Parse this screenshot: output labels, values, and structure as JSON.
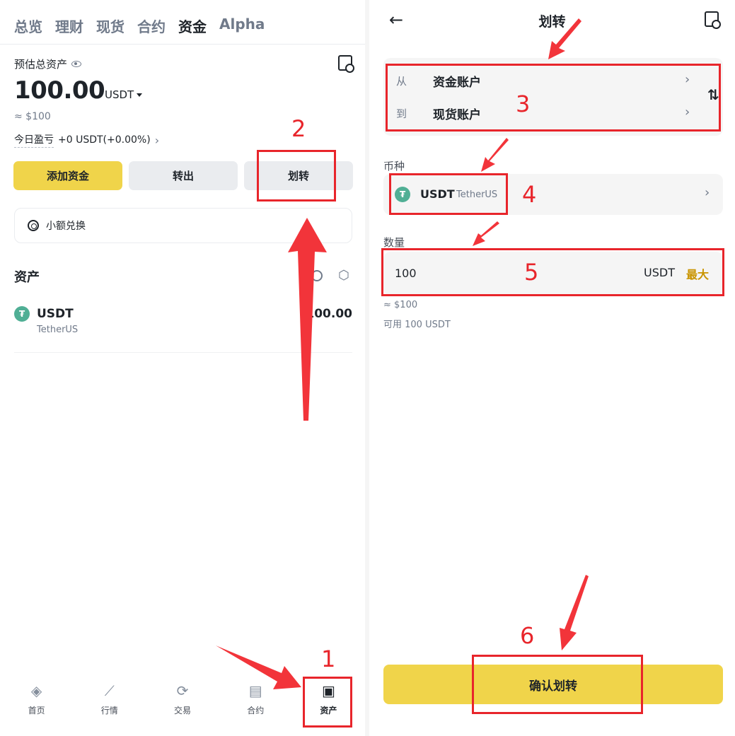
{
  "left": {
    "top_tabs": [
      "总览",
      "理财",
      "现货",
      "合约",
      "资金",
      "Alpha"
    ],
    "active_tab_index": 4,
    "estimated_label": "预估总资产",
    "balance": "100.00",
    "balance_unit": "USDT",
    "approx_usd": "≈ $100",
    "pnl_label": "今日盈亏",
    "pnl_value": "+0 USDT(+0.00%)",
    "buttons": {
      "add": "添加资金",
      "withdraw": "转出",
      "transfer": "划转"
    },
    "small_exchange": "小额兑换",
    "assets_title": "资产",
    "asset": {
      "symbol": "USDT",
      "name": "TetherUS",
      "amount": "100.00"
    },
    "nav": [
      {
        "label": "首页",
        "icon": "home-diamond-icon"
      },
      {
        "label": "行情",
        "icon": "market-trend-icon"
      },
      {
        "label": "交易",
        "icon": "trade-swap-icon"
      },
      {
        "label": "合约",
        "icon": "futures-doc-icon"
      },
      {
        "label": "资产",
        "icon": "wallet-icon"
      }
    ],
    "active_nav_index": 4
  },
  "right": {
    "title": "划转",
    "from_label": "从",
    "from_account": "资金账户",
    "to_label": "到",
    "to_account": "现货账户",
    "coin_label": "币种",
    "coin_symbol": "USDT",
    "coin_name": "TetherUS",
    "amount_label": "数量",
    "amount_value": "100",
    "amount_unit": "USDT",
    "max_label": "最大",
    "amount_approx": "≈ $100",
    "available": "可用 100 USDT",
    "confirm": "确认划转"
  },
  "annotations": [
    "1",
    "2",
    "3",
    "4",
    "5",
    "6"
  ],
  "colors": {
    "accent_yellow": "#f0d44a",
    "annotation_red": "#e8252b",
    "max_gold": "#c99400",
    "tether_green": "#50af95"
  }
}
